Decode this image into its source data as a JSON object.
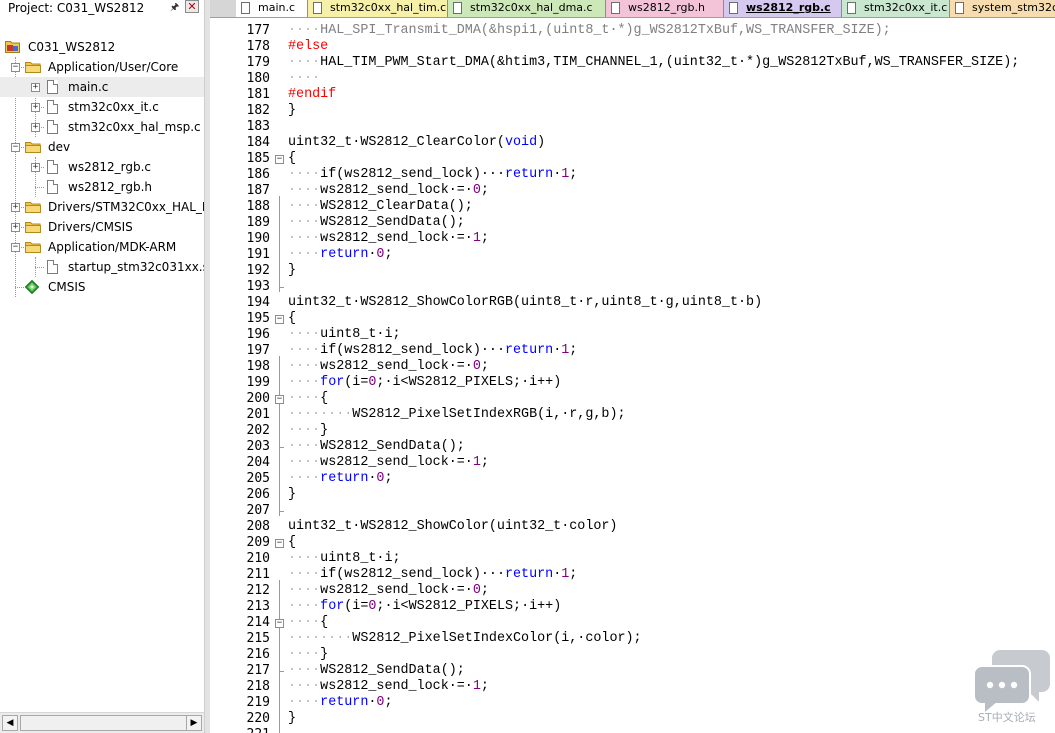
{
  "project_panel": {
    "title": "Project: C031_WS2812",
    "tree": [
      {
        "label": "C031_WS2812",
        "depth": 0,
        "icon": "project-icon",
        "expander": "-"
      },
      {
        "label": "Application/User/Core",
        "depth": 1,
        "icon": "folder-icon",
        "expander": "-"
      },
      {
        "label": "main.c",
        "depth": 2,
        "icon": "file-icon",
        "expander": "+",
        "selected": true
      },
      {
        "label": "stm32c0xx_it.c",
        "depth": 2,
        "icon": "file-icon",
        "expander": "+"
      },
      {
        "label": "stm32c0xx_hal_msp.c",
        "depth": 2,
        "icon": "file-icon",
        "expander": "+"
      },
      {
        "label": "dev",
        "depth": 1,
        "icon": "folder-icon",
        "expander": "-"
      },
      {
        "label": "ws2812_rgb.c",
        "depth": 2,
        "icon": "file-icon",
        "expander": "+"
      },
      {
        "label": "ws2812_rgb.h",
        "depth": 2,
        "icon": "file-icon",
        "expander": ""
      },
      {
        "label": "Drivers/STM32C0xx_HAL_Driv",
        "depth": 1,
        "icon": "folder-icon",
        "expander": "+"
      },
      {
        "label": "Drivers/CMSIS",
        "depth": 1,
        "icon": "folder-icon",
        "expander": "+"
      },
      {
        "label": "Application/MDK-ARM",
        "depth": 1,
        "icon": "folder-icon",
        "expander": "-"
      },
      {
        "label": "startup_stm32c031xx.s",
        "depth": 2,
        "icon": "file-icon",
        "expander": ""
      },
      {
        "label": "CMSIS",
        "depth": 1,
        "icon": "component-gem-icon",
        "expander": ""
      }
    ]
  },
  "tabs": [
    {
      "label": "main.c",
      "color": "#ffffff",
      "active": false
    },
    {
      "label": "stm32c0xx_hal_tim.c",
      "color": "#f6f0a8",
      "active": false
    },
    {
      "label": "stm32c0xx_hal_dma.c",
      "color": "#cde8b8",
      "active": false
    },
    {
      "label": "ws2812_rgb.h",
      "color": "#f3c4d8",
      "active": false
    },
    {
      "label": "ws2812_rgb.c",
      "color": "#d6c9ef",
      "active": true
    },
    {
      "label": "stm32c0xx_it.c",
      "color": "#c9e6cf",
      "active": false
    },
    {
      "label": "system_stm32c",
      "color": "#f6dcae",
      "active": false
    }
  ],
  "colors": {
    "keyword": "#0000ff",
    "preprocessor": "#ff0000",
    "inactive": "#808080",
    "number": "#800080",
    "plain": "#000000"
  },
  "code_lines": [
    {
      "n": "177",
      "seg": [
        [
          "ws",
          "····"
        ],
        [
          "dim",
          "HAL_SPI_Transmit_DMA(&hspi1,(uint8_t·*)g_WS2812TxBuf,WS_TRANSFER_SIZE);"
        ]
      ]
    },
    {
      "n": "178",
      "seg": [
        [
          "pp",
          "#else"
        ]
      ]
    },
    {
      "n": "179",
      "seg": [
        [
          "ws",
          "····"
        ],
        [
          "t",
          "HAL_TIM_PWM_Start_DMA(&htim3,TIM_CHANNEL_1,(uint32_t·*)g_WS2812TxBuf,WS_TRANSFER_SIZE);"
        ]
      ]
    },
    {
      "n": "180",
      "seg": [
        [
          "ws",
          "····"
        ]
      ]
    },
    {
      "n": "181",
      "seg": [
        [
          "pp",
          "#endif"
        ]
      ]
    },
    {
      "n": "182",
      "seg": [
        [
          "t",
          "}"
        ]
      ]
    },
    {
      "n": "183",
      "seg": []
    },
    {
      "n": "184",
      "seg": [
        [
          "t",
          "uint32_t·WS2812_ClearColor("
        ],
        [
          "kw",
          "void"
        ],
        [
          "t",
          ")"
        ]
      ]
    },
    {
      "n": "185",
      "seg": [
        [
          "t",
          "{"
        ]
      ],
      "fold": "-"
    },
    {
      "n": "186",
      "seg": [
        [
          "ws",
          "····"
        ],
        [
          "t",
          "if(ws2812_send_lock)···"
        ],
        [
          "kw",
          "return"
        ],
        [
          "t",
          "·"
        ],
        [
          "num",
          "1"
        ],
        [
          "t",
          ";"
        ]
      ]
    },
    {
      "n": "187",
      "seg": [
        [
          "ws",
          "····"
        ],
        [
          "t",
          "ws2812_send_lock·=·"
        ],
        [
          "num",
          "0"
        ],
        [
          "t",
          ";"
        ]
      ]
    },
    {
      "n": "188",
      "seg": [
        [
          "ws",
          "····"
        ],
        [
          "t",
          "WS2812_ClearData();"
        ]
      ]
    },
    {
      "n": "189",
      "seg": [
        [
          "ws",
          "····"
        ],
        [
          "t",
          "WS2812_SendData();"
        ]
      ]
    },
    {
      "n": "190",
      "seg": [
        [
          "ws",
          "····"
        ],
        [
          "t",
          "ws2812_send_lock·=·"
        ],
        [
          "num",
          "1"
        ],
        [
          "t",
          ";"
        ]
      ]
    },
    {
      "n": "191",
      "seg": [
        [
          "ws",
          "····"
        ],
        [
          "kw",
          "return"
        ],
        [
          "t",
          "·"
        ],
        [
          "num",
          "0"
        ],
        [
          "t",
          ";"
        ]
      ]
    },
    {
      "n": "192",
      "seg": [
        [
          "t",
          "}"
        ]
      ]
    },
    {
      "n": "193",
      "seg": []
    },
    {
      "n": "194",
      "seg": [
        [
          "t",
          "uint32_t·WS2812_ShowColorRGB(uint8_t·r,uint8_t·g,uint8_t·b)"
        ]
      ]
    },
    {
      "n": "195",
      "seg": [
        [
          "t",
          "{"
        ]
      ],
      "fold": "-"
    },
    {
      "n": "196",
      "seg": [
        [
          "ws",
          "····"
        ],
        [
          "t",
          "uint8_t·i;"
        ]
      ]
    },
    {
      "n": "197",
      "seg": [
        [
          "ws",
          "····"
        ],
        [
          "t",
          "if(ws2812_send_lock)···"
        ],
        [
          "kw",
          "return"
        ],
        [
          "t",
          "·"
        ],
        [
          "num",
          "1"
        ],
        [
          "t",
          ";"
        ]
      ]
    },
    {
      "n": "198",
      "seg": [
        [
          "ws",
          "····"
        ],
        [
          "t",
          "ws2812_send_lock·=·"
        ],
        [
          "num",
          "0"
        ],
        [
          "t",
          ";"
        ]
      ]
    },
    {
      "n": "199",
      "seg": [
        [
          "ws",
          "····"
        ],
        [
          "kw",
          "for"
        ],
        [
          "t",
          "(i="
        ],
        [
          "num",
          "0"
        ],
        [
          "t",
          ";·i<WS2812_PIXELS;·i++)"
        ]
      ]
    },
    {
      "n": "200",
      "seg": [
        [
          "ws",
          "····"
        ],
        [
          "t",
          "{"
        ]
      ],
      "fold": "-"
    },
    {
      "n": "201",
      "seg": [
        [
          "ws",
          "········"
        ],
        [
          "t",
          "WS2812_PixelSetIndexRGB(i,·r,g,b);"
        ]
      ]
    },
    {
      "n": "202",
      "seg": [
        [
          "ws",
          "····"
        ],
        [
          "t",
          "}"
        ]
      ]
    },
    {
      "n": "203",
      "seg": [
        [
          "ws",
          "····"
        ],
        [
          "t",
          "WS2812_SendData();"
        ]
      ]
    },
    {
      "n": "204",
      "seg": [
        [
          "ws",
          "····"
        ],
        [
          "t",
          "ws2812_send_lock·=·"
        ],
        [
          "num",
          "1"
        ],
        [
          "t",
          ";"
        ]
      ]
    },
    {
      "n": "205",
      "seg": [
        [
          "ws",
          "····"
        ],
        [
          "kw",
          "return"
        ],
        [
          "t",
          "·"
        ],
        [
          "num",
          "0"
        ],
        [
          "t",
          ";"
        ]
      ]
    },
    {
      "n": "206",
      "seg": [
        [
          "t",
          "}"
        ]
      ]
    },
    {
      "n": "207",
      "seg": []
    },
    {
      "n": "208",
      "seg": [
        [
          "t",
          "uint32_t·WS2812_ShowColor(uint32_t·color)"
        ]
      ]
    },
    {
      "n": "209",
      "seg": [
        [
          "t",
          "{"
        ]
      ],
      "fold": "-"
    },
    {
      "n": "210",
      "seg": [
        [
          "ws",
          "····"
        ],
        [
          "t",
          "uint8_t·i;"
        ]
      ]
    },
    {
      "n": "211",
      "seg": [
        [
          "ws",
          "····"
        ],
        [
          "t",
          "if(ws2812_send_lock)···"
        ],
        [
          "kw",
          "return"
        ],
        [
          "t",
          "·"
        ],
        [
          "num",
          "1"
        ],
        [
          "t",
          ";"
        ]
      ]
    },
    {
      "n": "212",
      "seg": [
        [
          "ws",
          "····"
        ],
        [
          "t",
          "ws2812_send_lock·=·"
        ],
        [
          "num",
          "0"
        ],
        [
          "t",
          ";"
        ]
      ]
    },
    {
      "n": "213",
      "seg": [
        [
          "ws",
          "····"
        ],
        [
          "kw",
          "for"
        ],
        [
          "t",
          "(i="
        ],
        [
          "num",
          "0"
        ],
        [
          "t",
          ";·i<WS2812_PIXELS;·i++)"
        ]
      ]
    },
    {
      "n": "214",
      "seg": [
        [
          "ws",
          "····"
        ],
        [
          "t",
          "{"
        ]
      ],
      "fold": "-"
    },
    {
      "n": "215",
      "seg": [
        [
          "ws",
          "········"
        ],
        [
          "t",
          "WS2812_PixelSetIndexColor(i,·color);"
        ]
      ]
    },
    {
      "n": "216",
      "seg": [
        [
          "ws",
          "····"
        ],
        [
          "t",
          "}"
        ]
      ]
    },
    {
      "n": "217",
      "seg": [
        [
          "ws",
          "····"
        ],
        [
          "t",
          "WS2812_SendData();"
        ]
      ]
    },
    {
      "n": "218",
      "seg": [
        [
          "ws",
          "····"
        ],
        [
          "t",
          "ws2812_send_lock·=·"
        ],
        [
          "num",
          "1"
        ],
        [
          "t",
          ";"
        ]
      ]
    },
    {
      "n": "219",
      "seg": [
        [
          "ws",
          "····"
        ],
        [
          "kw",
          "return"
        ],
        [
          "t",
          "·"
        ],
        [
          "num",
          "0"
        ],
        [
          "t",
          ";"
        ]
      ]
    },
    {
      "n": "220",
      "seg": [
        [
          "t",
          "}"
        ]
      ]
    },
    {
      "n": "221",
      "seg": []
    }
  ],
  "watermark": {
    "text": "ST中文论坛",
    "icon": "chat-bubbles-icon"
  }
}
